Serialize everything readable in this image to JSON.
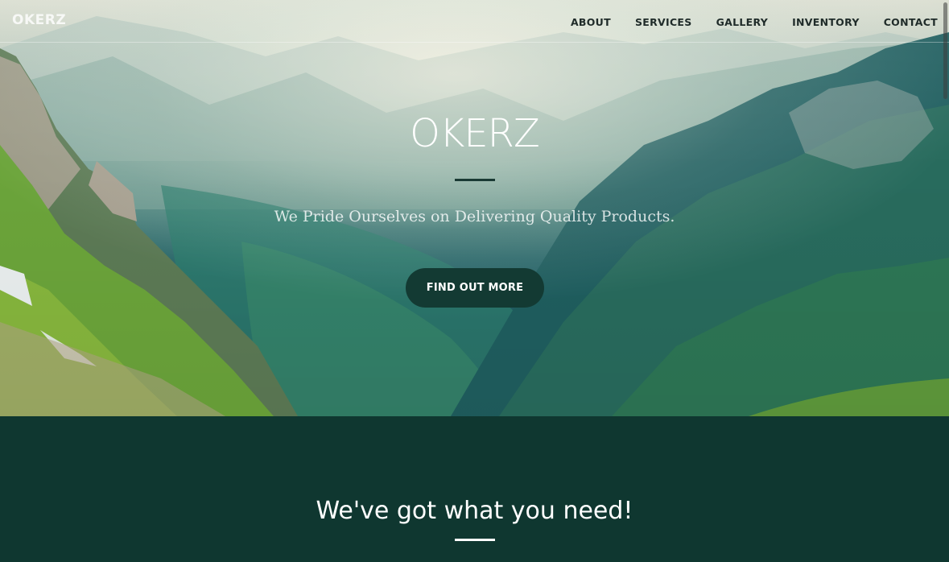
{
  "navbar": {
    "brand": "OKERZ",
    "links": [
      {
        "label": "ABOUT"
      },
      {
        "label": "SERVICES"
      },
      {
        "label": "GALLERY"
      },
      {
        "label": "INVENTORY"
      },
      {
        "label": "CONTACT"
      }
    ]
  },
  "hero": {
    "title": "OKERZ",
    "subtitle": "We Pride Ourselves on Delivering Quality Products.",
    "cta_label": "FIND OUT MORE"
  },
  "section": {
    "heading": "We've got what you need!"
  },
  "colors": {
    "section_background": "#0f3730",
    "button_background": "#133a33",
    "nav_text": "#1f2b29"
  }
}
